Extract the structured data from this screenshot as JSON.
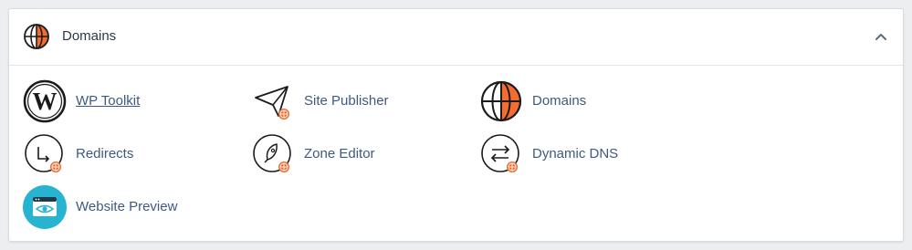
{
  "section": {
    "title": "Domains",
    "header_icon": "globe-icon",
    "collapse_icon": "chevron-up-icon"
  },
  "colors": {
    "accent_orange": "#f26d2f",
    "link_blue": "#3d5a80",
    "icon_black": "#1b1b1b",
    "preview_teal": "#28b4d1"
  },
  "items": [
    {
      "label": "WP Toolkit",
      "icon": "wordpress-icon"
    },
    {
      "label": "Site Publisher",
      "icon": "paper-plane-icon"
    },
    {
      "label": "Domains",
      "icon": "globe-icon"
    },
    {
      "label": "Redirects",
      "icon": "redirect-arrow-icon"
    },
    {
      "label": "Zone Editor",
      "icon": "rocket-icon"
    },
    {
      "label": "Dynamic DNS",
      "icon": "swap-arrows-icon"
    },
    {
      "label": "Website Preview",
      "icon": "eye-window-icon"
    }
  ]
}
